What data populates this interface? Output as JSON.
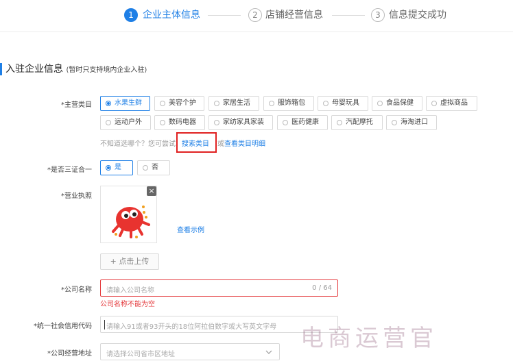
{
  "steps": [
    {
      "num": "1",
      "label": "企业主体信息"
    },
    {
      "num": "2",
      "label": "店铺经营信息"
    },
    {
      "num": "3",
      "label": "信息提交成功"
    }
  ],
  "section": {
    "title": "入驻企业信息",
    "note": "(暂时只支持境内企业入驻)"
  },
  "category": {
    "label": "*主营类目",
    "options": [
      "水果生鲜",
      "美容个护",
      "家居生活",
      "服饰箱包",
      "母婴玩具",
      "食品保健",
      "虚拟商品",
      "运动户外",
      "数码电器",
      "家纺家具家装",
      "医药健康",
      "汽配摩托",
      "海淘进口"
    ],
    "selected": "水果生鲜",
    "hint": "不知道选哪个？您可尝试",
    "search_link": "搜索类目",
    "or_text": "或",
    "detail_link": "查看类目明细"
  },
  "three_in_one": {
    "label": "*是否三证合一",
    "yes": "是",
    "no": "否",
    "selected": "是"
  },
  "license": {
    "label": "*营业执照",
    "close": "×",
    "example_link": "查看示例",
    "upload_btn": "+ 点击上传"
  },
  "company_name": {
    "label": "*公司名称",
    "placeholder": "请输入公司名称",
    "count": "0 / 64",
    "error": "公司名称不能为空"
  },
  "credit_code": {
    "label": "*统一社会信用代码",
    "placeholder": "请输入91或者93开头的18位阿拉伯数字或大写英文字母"
  },
  "address": {
    "label": "*公司经营地址",
    "placeholder": "请选择公司省市区地址"
  },
  "watermark": "电商运营官",
  "colors": {
    "primary": "#1e7fe6",
    "error": "#e4393c",
    "highlight": "#e02020"
  }
}
